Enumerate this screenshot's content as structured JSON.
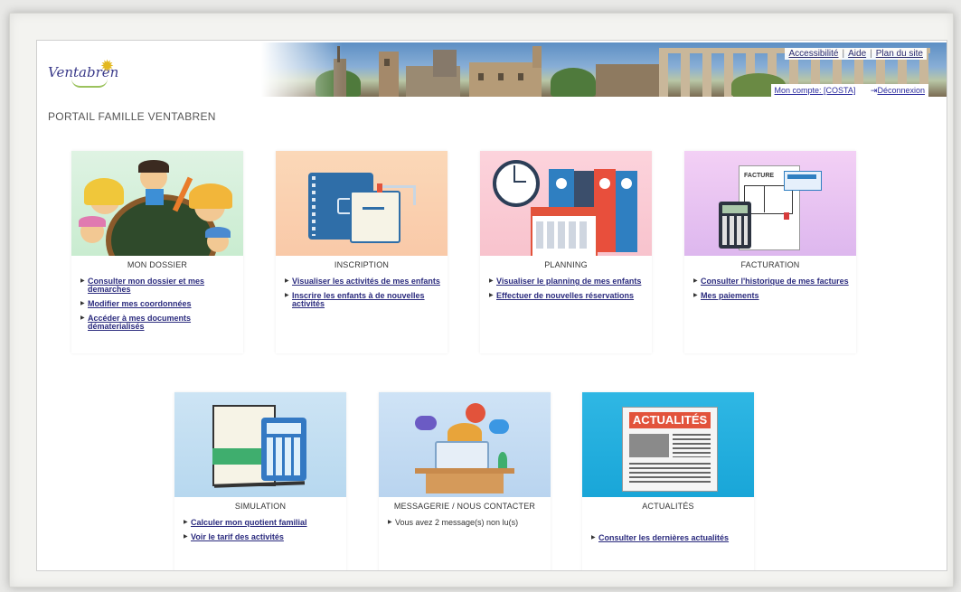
{
  "header": {
    "logo_text": "Ventabren",
    "top_links": [
      "Accessibilité",
      "Aide",
      "Plan du site"
    ],
    "account_label": "Mon compte: [COSTA]",
    "logout_label": "Déconnexion",
    "portal_title": "PORTAIL FAMILLE VENTABREN"
  },
  "cards": [
    {
      "title": "MON DOSSIER",
      "links": [
        "Consulter mon dossier et mes demarches",
        "Modifier mes coordonnées",
        "Accéder à mes documents dématerialisés"
      ]
    },
    {
      "title": "INSCRIPTION",
      "links": [
        "Visualiser les activités de mes enfants",
        "Inscrire les enfants à de nouvelles activités"
      ]
    },
    {
      "title": "PLANNING",
      "links": [
        "Visualiser le planning de mes enfants",
        "Effectuer de nouvelles réservations"
      ]
    },
    {
      "title": "FACTURATION",
      "links": [
        "Consulter l'historique de mes factures",
        "Mes paiements"
      ]
    },
    {
      "title": "SIMULATION",
      "links": [
        "Calculer mon quotient familial",
        "Voir le tarif des activités"
      ]
    },
    {
      "title": "MESSAGERIE / NOUS CONTACTER",
      "info": "Vous avez 2 message(s) non lu(s)"
    },
    {
      "title": "ACTUALITÉS",
      "links": [
        "Consulter les dernières actualités"
      ],
      "image_text": "ACTUALITÉS"
    }
  ],
  "invoice_text": "FACTURE",
  "colors": {
    "link": "#2b2b7e",
    "accent_blue": "#2f7fc1"
  }
}
